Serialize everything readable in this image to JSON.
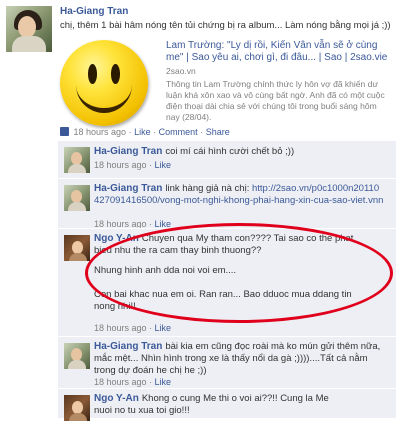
{
  "post": {
    "author": "Ha-Giang Tran",
    "text": "chị, thêm 1 bài hâm nóng tên tủi chứng bị ra album... Làm nóng bằng mọi já ;))",
    "link": {
      "title": "Lam Trường: \"Ly dị rồi, Kiến Vân vẫn sẽ ở cùng me\" | Sao yêu ai, chơi gì, đi đâu... | Sao | 2sao.vie",
      "domain": "2sao.vn",
      "description": "Thông tin Lam Trường chính thức ly hôn vợ đã khiến dư luận khá xôn xao và vô cùng bất ngờ. Anh đã có một cuộc điện thoại dài chia sẻ với chúng tôi trong buổi sáng hôm nay (28/04)."
    },
    "meta": {
      "time": "18 hours ago",
      "separator": "·",
      "like": "Like",
      "comment": "Comment",
      "share": "Share"
    }
  },
  "comments": [
    {
      "author": "Ha-Giang Tran",
      "text": "coi mí cái hình cười chết bỏ ;))",
      "time": "18 hours ago",
      "like": "Like"
    },
    {
      "author": "Ha-Giang Tran",
      "text": "link hàng giả nà chị:",
      "link": "http://2sao.vn/p0c1000n20110427091416500/vong-mot-nghi-khong-phai-hang-xin-cua-sao-viet.vnn",
      "time": "18 hours ago",
      "like": "Like"
    },
    {
      "author": "Ngo Y-An",
      "text_lines": [
        "Chuyen qua My tham con???? Tai sao co the phat bieu nhu the ra cam thay binh thuong??",
        "Nhung hinh anh dda noi voi em....",
        "Con bai khac nua em oi. Ran ran... Bao dduoc mua ddang tin nong nhi!!"
      ],
      "time": "18 hours ago",
      "like": "Like"
    },
    {
      "author": "Ha-Giang Tran",
      "text": "bài kia em cũng đọc roài mà ko mún gửi thêm nữa, mắc mệt... Nhìn hình trong xe là thấy nổi da gà ;))))....Tất cả nằm trong dự đoán he chị he ;))",
      "time": "18 hours ago",
      "like": "Like"
    },
    {
      "author": "Ngo Y-An",
      "text": "Khong o cung Me thi o voi ai??!! Cung la Me nuoi no tu xua toi gio!!!",
      "time": "18 hours ago",
      "like": "Like"
    }
  ],
  "colors": {
    "brand": "#3b5998",
    "comment_bg": "#edeff4",
    "highlight": "#e0001b"
  },
  "icons": {
    "attachment": "smiley-face",
    "post_source": "facebook-icon"
  }
}
